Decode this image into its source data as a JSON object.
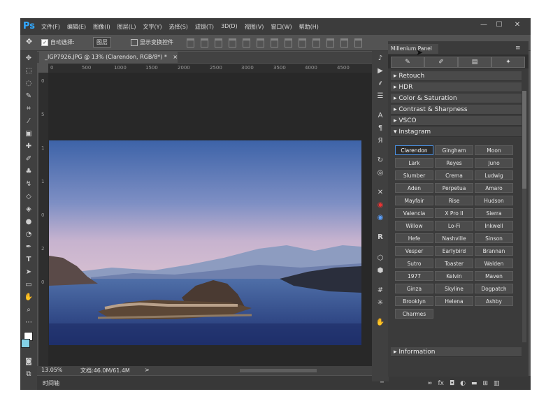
{
  "app": {
    "logo": "Ps",
    "menu": [
      "文件(F)",
      "编辑(E)",
      "图像(I)",
      "图层(L)",
      "文字(Y)",
      "选择(S)",
      "滤镜(T)",
      "3D(D)",
      "视图(V)",
      "窗口(W)",
      "帮助(H)"
    ],
    "window_buttons": [
      "—",
      "☐",
      "✕"
    ]
  },
  "options": {
    "auto_select_label": "自动选择:",
    "auto_select_value": "图层",
    "show_transform_label": "显示变换控件"
  },
  "document": {
    "tab_title": "_IGP7926.JPG @ 13% (Clarendon, RGB/8*) *",
    "tab_close": "×",
    "ruler_h": [
      "0",
      "500",
      "1000",
      "1500",
      "2000",
      "2500",
      "3000",
      "3500",
      "4000",
      "4500"
    ],
    "ruler_v": [
      "0",
      "5",
      "1",
      "1",
      "0",
      "2",
      "0"
    ]
  },
  "status": {
    "zoom": "13.05%",
    "doc_info": "文档:46.0M/61.4M",
    "arrow": ">"
  },
  "timeline": {
    "label": "时间轴"
  },
  "panel": {
    "tab": "Millenium Panel",
    "sections": [
      {
        "label": "Retouch",
        "open": false
      },
      {
        "label": "HDR",
        "open": false
      },
      {
        "label": "Color & Saturation",
        "open": false
      },
      {
        "label": "Contrast & Sharpness",
        "open": false
      },
      {
        "label": "VSCO",
        "open": false
      },
      {
        "label": "Instagram",
        "open": true
      }
    ],
    "filters": [
      "Clarendon",
      "Gingham",
      "Moon",
      "Lark",
      "Reyes",
      "Juno",
      "Slumber",
      "Crema",
      "Ludwig",
      "Aden",
      "Perpetua",
      "Amaro",
      "Mayfair",
      "Rise",
      "Hudson",
      "Valencia",
      "X Pro II",
      "Sierra",
      "Willow",
      "Lo-Fi",
      "Inkwell",
      "Hefe",
      "Nashville",
      "Sinson",
      "Vesper",
      "Earlybird",
      "Brannan",
      "Sutro",
      "Toaster",
      "Walden",
      "1977",
      "Kelvin",
      "Maven",
      "Ginza",
      "Skyline",
      "Dogpatch",
      "Brooklyn",
      "Helena",
      "Ashby",
      "Charmes"
    ],
    "active_filter": "Clarendon",
    "footer_section": "Information"
  },
  "colors": {
    "accent": "#4a8fe0",
    "ps_blue": "#31a8ff"
  }
}
